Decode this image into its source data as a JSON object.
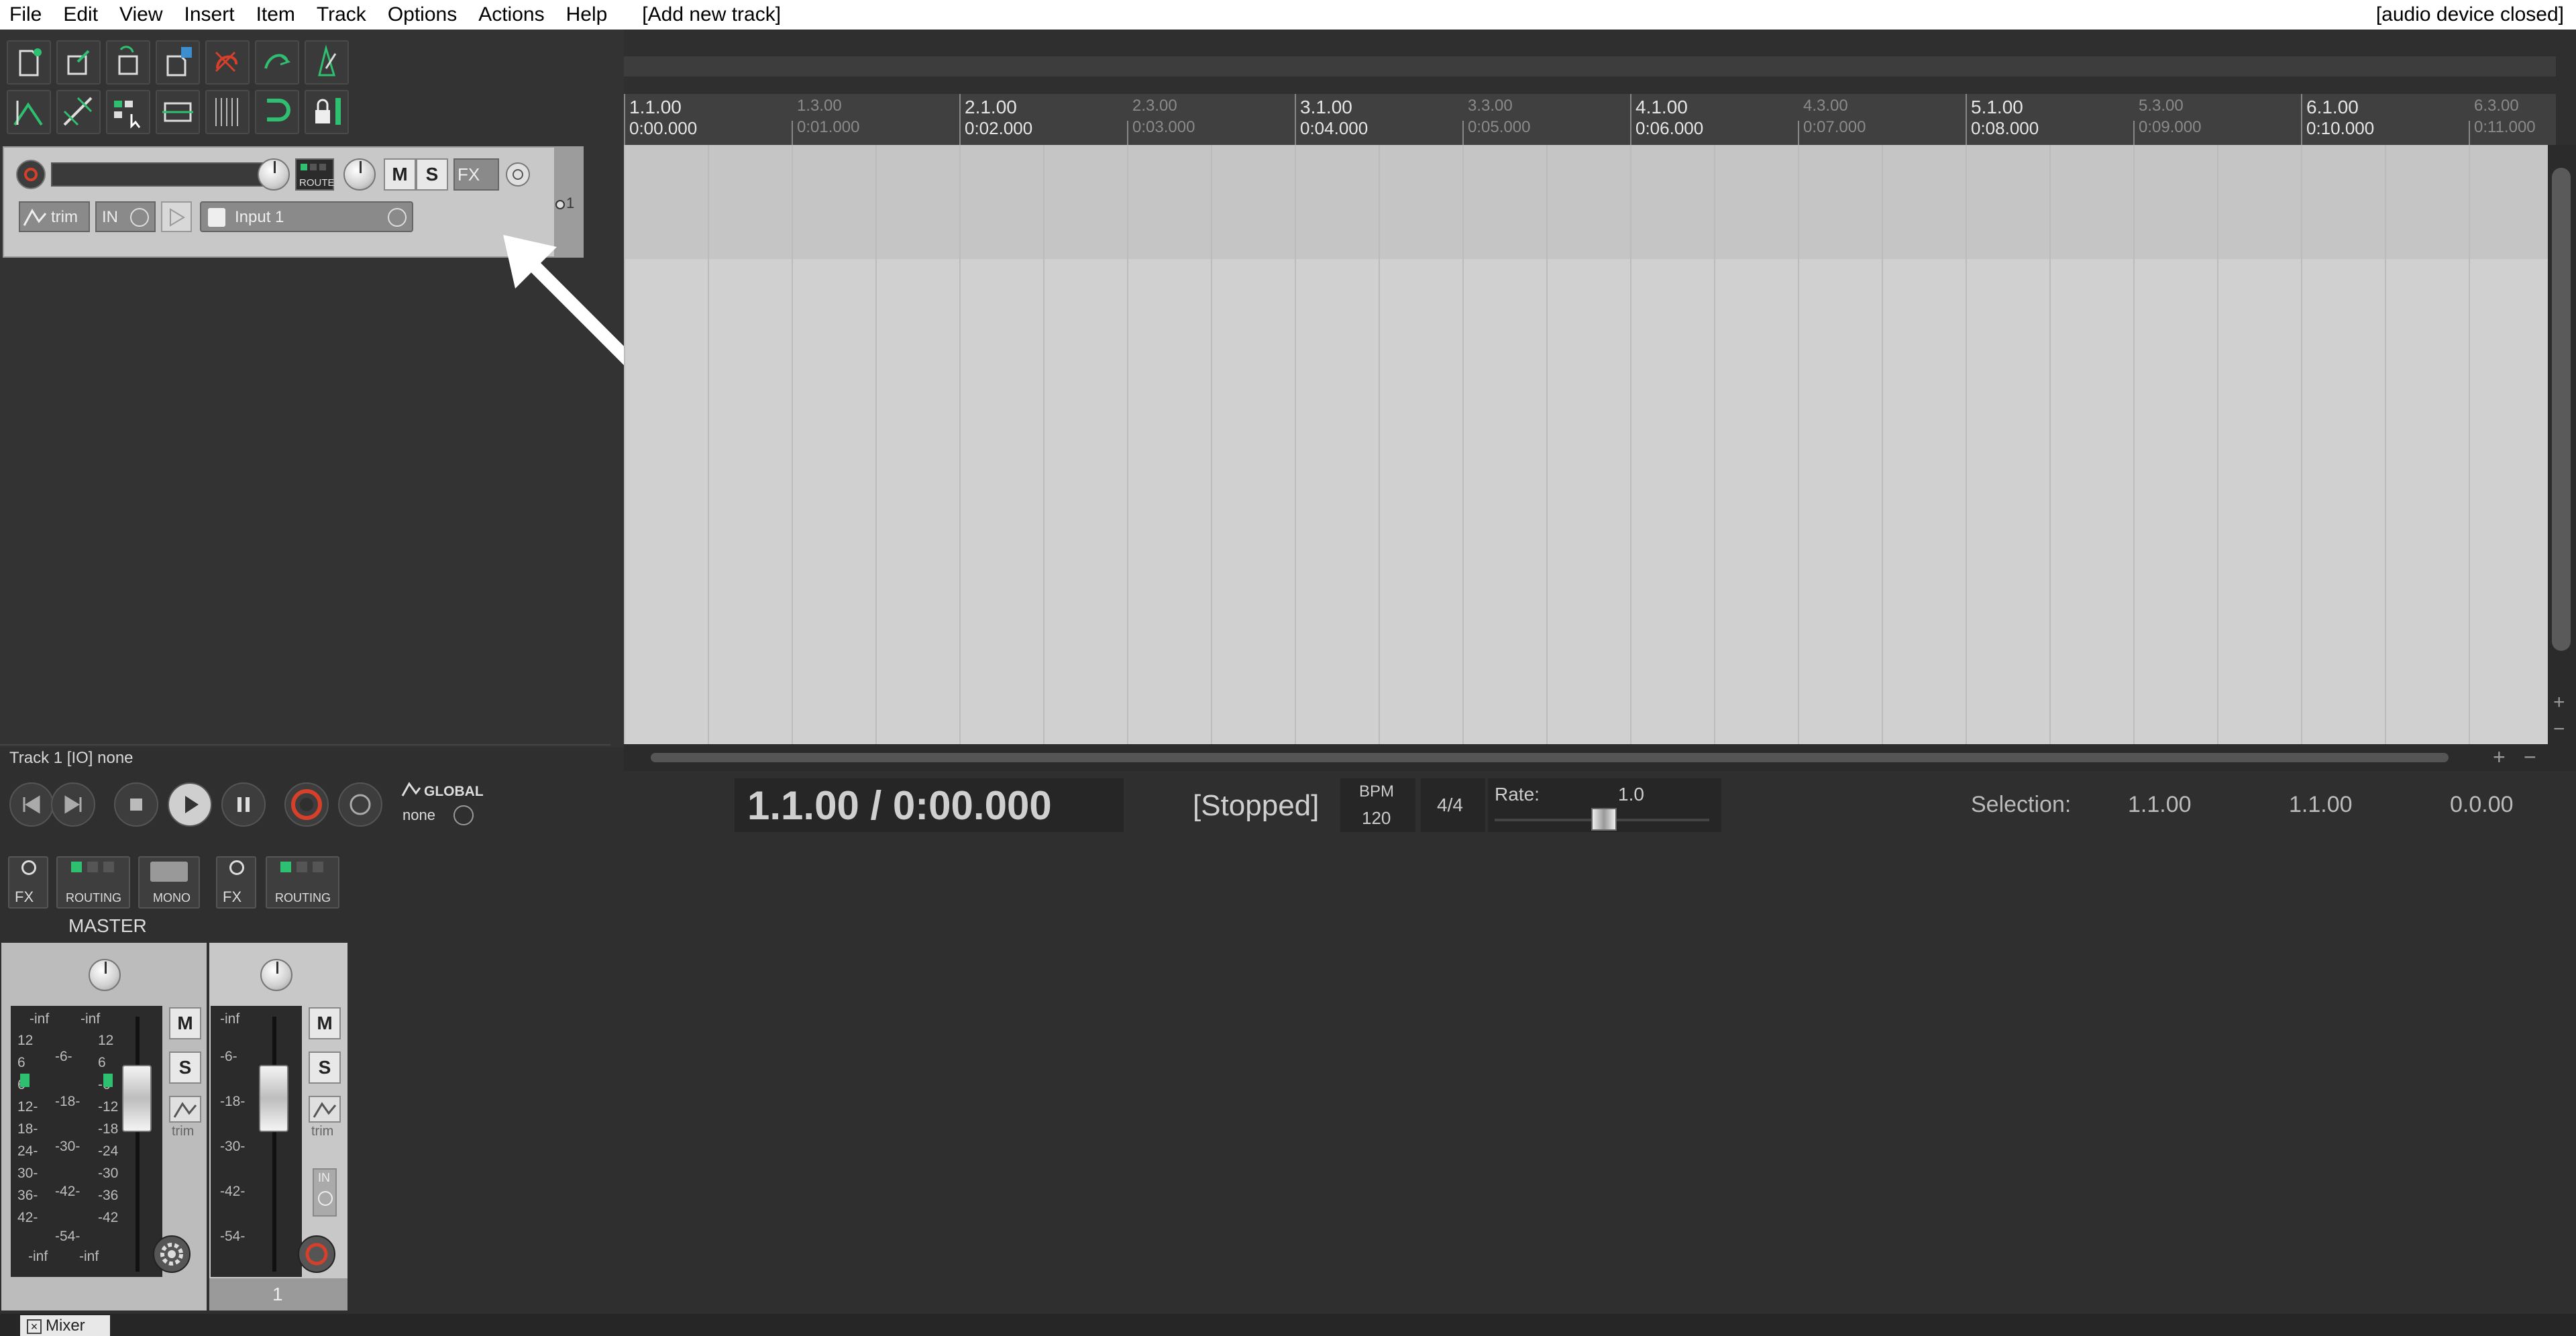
{
  "menu": {
    "items": [
      "File",
      "Edit",
      "View",
      "Insert",
      "Item",
      "Track",
      "Options",
      "Actions",
      "Help"
    ],
    "action": "[Add new track]",
    "status": "[audio device closed]"
  },
  "track1": {
    "route_label": "ROUTE",
    "mute": "M",
    "solo": "S",
    "fx": "FX",
    "trim": "trim",
    "in": "IN",
    "input": "Input 1",
    "number": "1"
  },
  "status_line": "Track 1 [IO] none",
  "ruler": {
    "measures": [
      {
        "bar": "1.1.00",
        "time": "0:00.000",
        "major": true
      },
      {
        "bar": "1.3.00",
        "time": "0:01.000",
        "major": false
      },
      {
        "bar": "2.1.00",
        "time": "0:02.000",
        "major": true
      },
      {
        "bar": "2.3.00",
        "time": "0:03.000",
        "major": false
      },
      {
        "bar": "3.1.00",
        "time": "0:04.000",
        "major": true
      },
      {
        "bar": "3.3.00",
        "time": "0:05.000",
        "major": false
      },
      {
        "bar": "4.1.00",
        "time": "0:06.000",
        "major": true
      },
      {
        "bar": "4.3.00",
        "time": "0:07.000",
        "major": false
      },
      {
        "bar": "5.1.00",
        "time": "0:08.000",
        "major": true
      },
      {
        "bar": "5.3.00",
        "time": "0:09.000",
        "major": false
      },
      {
        "bar": "6.1.00",
        "time": "0:10.000",
        "major": true
      },
      {
        "bar": "6.3.00",
        "time": "0:11.000",
        "major": false
      }
    ]
  },
  "transport": {
    "global_label": "GLOBAL",
    "global_value": "none",
    "time": "1.1.00 / 0:00.000",
    "state": "[Stopped]",
    "bpm_label": "BPM",
    "bpm": "120",
    "signature": "4/4",
    "rate_label": "Rate:",
    "rate": "1.0",
    "selection_label": "Selection:",
    "selection_start": "1.1.00",
    "selection_end": "1.1.00",
    "selection_length": "0.0.00"
  },
  "mixer": {
    "master": {
      "name": "MASTER",
      "fx": "FX",
      "routing": "ROUTING",
      "mono": "MONO",
      "mute": "M",
      "solo": "S",
      "trim": "trim",
      "peak_left": "-inf",
      "peak_right": "-inf",
      "scale_left": [
        "12",
        "6",
        "6-",
        "12-",
        "18-",
        "24-",
        "30-",
        "36-",
        "42-"
      ],
      "scale_mid": [
        "-6-",
        "-18-",
        "-30-",
        "-42-",
        "-54-"
      ],
      "scale_right": [
        "12",
        "6",
        "-6",
        "-12",
        "-18",
        "-24",
        "-30",
        "-36",
        "-42"
      ],
      "bottom_left": "-inf",
      "bottom_right": "-inf"
    },
    "track": {
      "fx": "FX",
      "routing": "ROUTING",
      "mute": "M",
      "solo": "S",
      "trim": "trim",
      "in": "IN",
      "peak": "-inf",
      "scale": [
        "-6-",
        "-18-",
        "-30-",
        "-42-",
        "-54-"
      ],
      "number": "1"
    },
    "tab": "Mixer"
  },
  "colors": {
    "accent_green": "#2fbf71",
    "record_red": "#d6402a"
  }
}
